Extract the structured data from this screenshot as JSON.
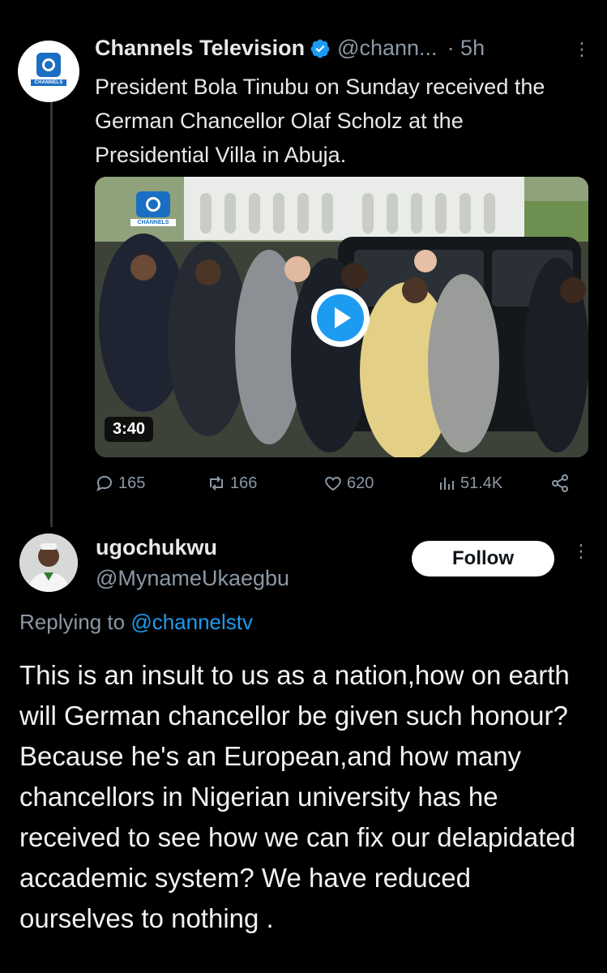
{
  "tweet": {
    "author_name": "Channels Television",
    "handle": "@chann...",
    "time": "· 5h",
    "text": "President Bola Tinubu on Sunday received the German Chancellor Olaf Scholz at the Presidential Villa in Abuja.",
    "logo_label": "CHANNELS",
    "video": {
      "duration": "3:40",
      "overlay_label": "CHANNELS"
    },
    "stats": {
      "replies": "165",
      "reposts": "166",
      "likes": "620",
      "views": "51.4K"
    }
  },
  "reply": {
    "author_name": "ugochukwu",
    "handle": "@MynameUkaegbu",
    "follow_label": "Follow",
    "replying_prefix": "Replying to",
    "replying_to": "@channelstv",
    "text": "This is an insult to us as a nation,how on earth will German chancellor be given such honour? Because he's an European,and how many chancellors in Nigerian university has he received to see how we can fix our delapidated accademic system? We have reduced ourselves to nothing ."
  },
  "colors": {
    "background": "#000000",
    "text": "#e7e9ea",
    "muted": "#8b98a5",
    "accent": "#1d9bf0",
    "channels_blue": "#1a6fc4"
  },
  "icons": [
    "verified-badge-icon",
    "more-options-icon",
    "reply-icon",
    "repost-icon",
    "like-icon",
    "views-icon",
    "share-icon",
    "play-icon"
  ]
}
